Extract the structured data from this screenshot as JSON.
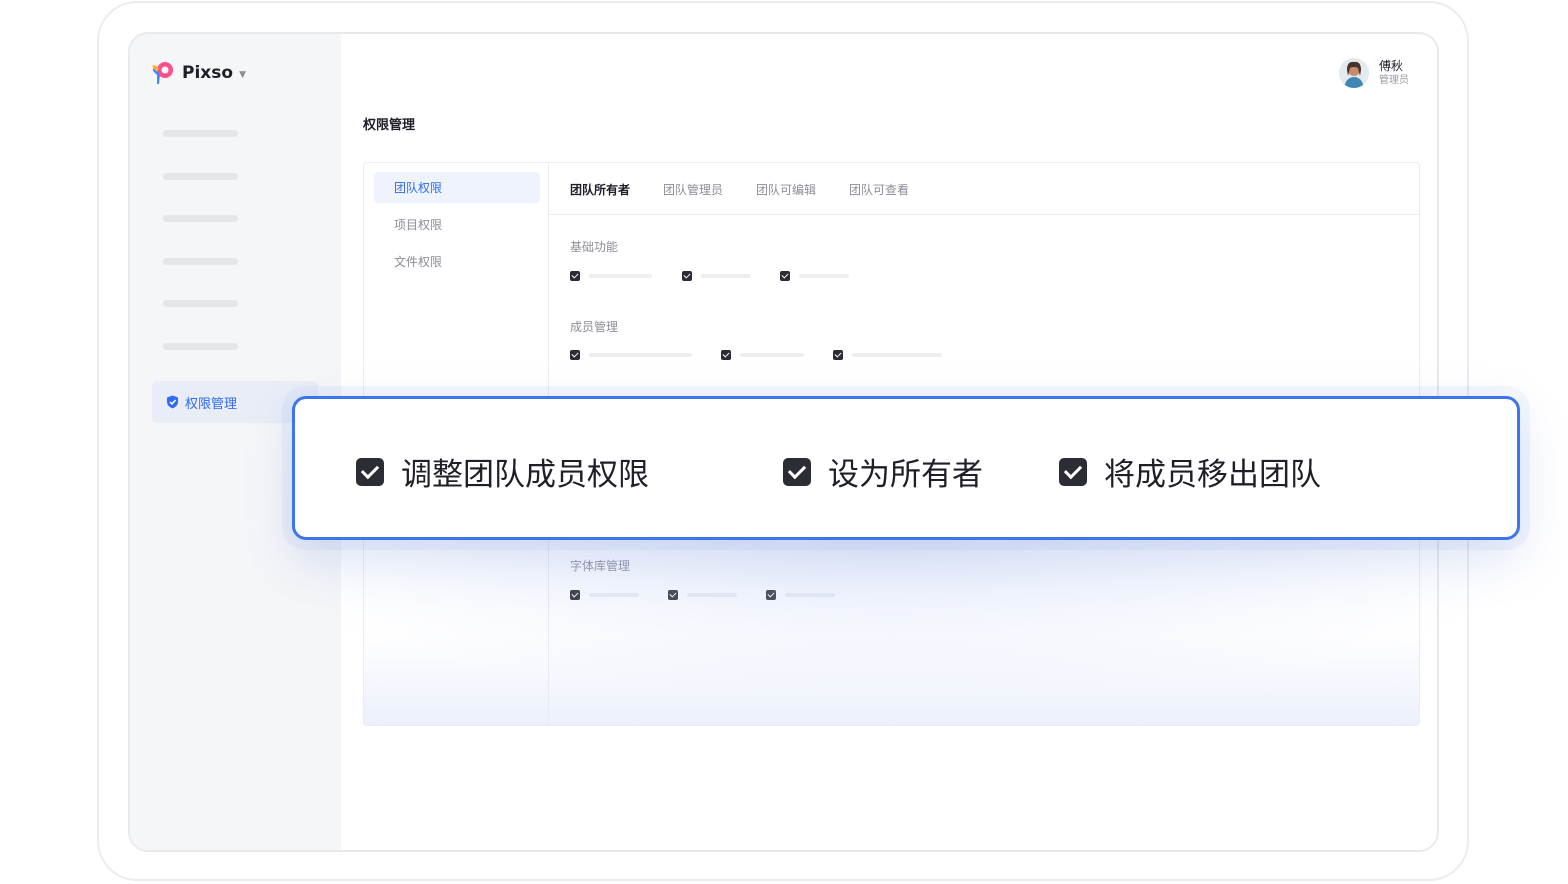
{
  "app": {
    "name": "Pixso"
  },
  "sidebar": {
    "active_item": "权限管理"
  },
  "user": {
    "name": "傅秋",
    "role": "管理员"
  },
  "page": {
    "title": "权限管理"
  },
  "permission_types": [
    "团队权限",
    "项目权限",
    "文件权限"
  ],
  "role_tabs": [
    "团队所有者",
    "团队管理员",
    "团队可编辑",
    "团队可查看"
  ],
  "sections": [
    "基础功能",
    "成员管理",
    "字体库管理"
  ],
  "popup": {
    "items": [
      "调整团队成员权限",
      "设为所有者",
      "将成员移出团队"
    ]
  },
  "colors": {
    "accent": "#2f6bf5",
    "popup_border": "#3d74f0",
    "checkbox": "#2c2c35"
  }
}
